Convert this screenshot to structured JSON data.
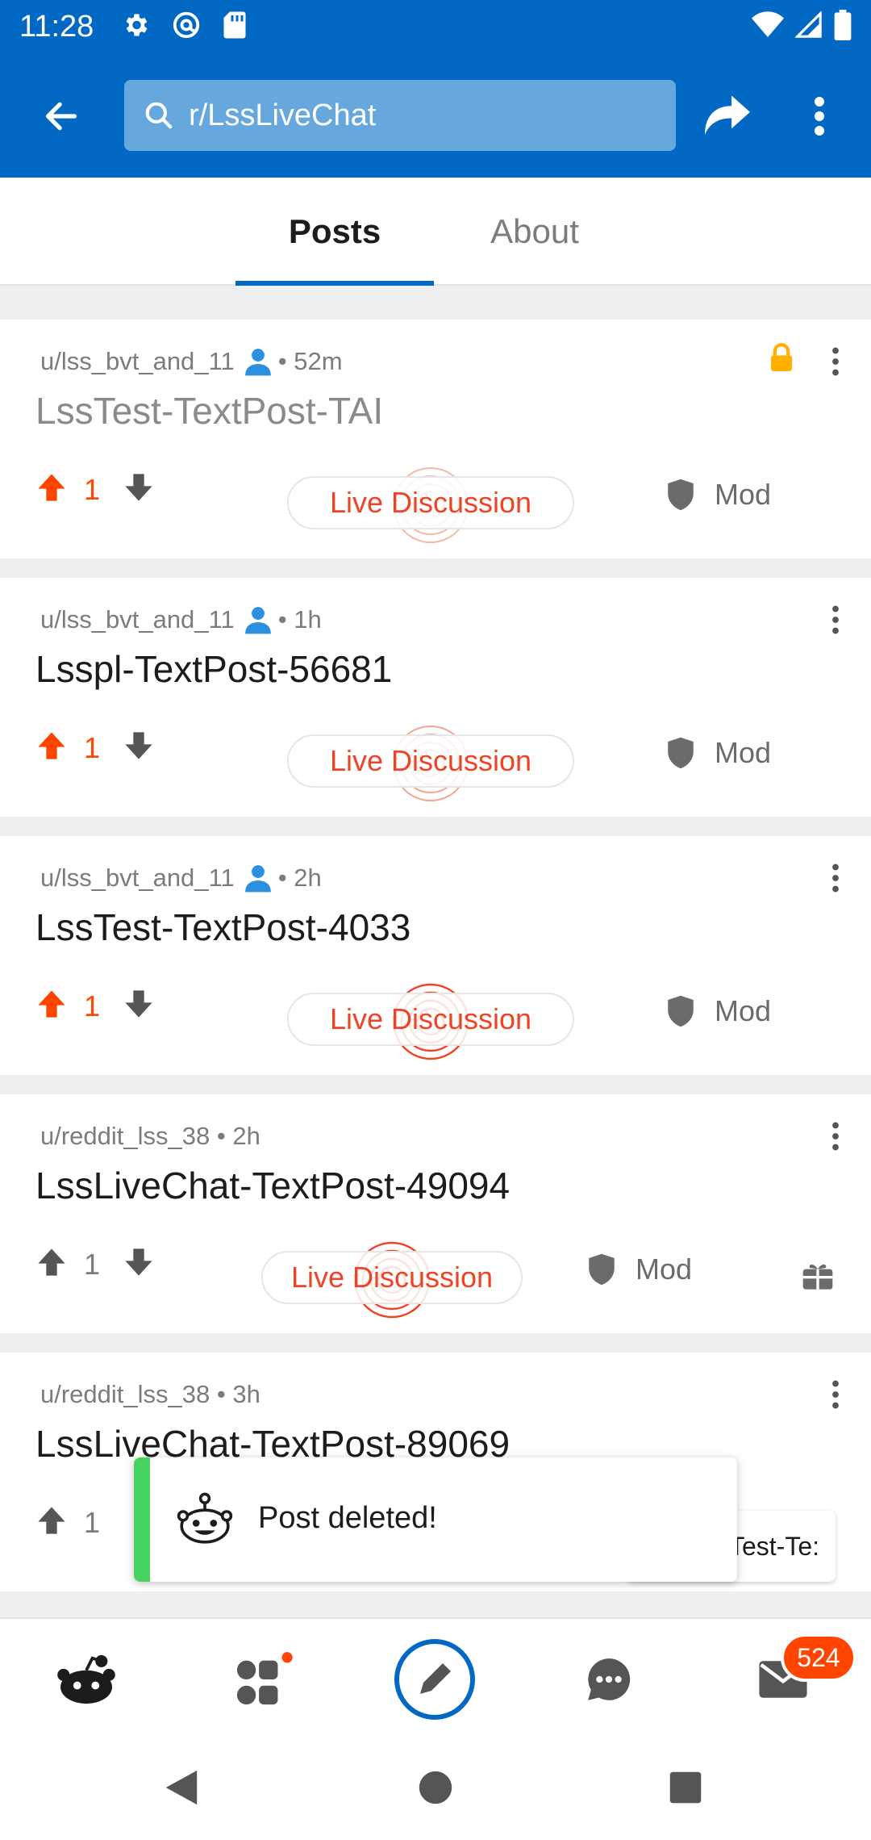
{
  "status_bar": {
    "time": "11:28",
    "left_icons": [
      "settings-icon",
      "at-sign-icon",
      "sd-card-icon"
    ],
    "right_icons": [
      "wifi-icon",
      "cell-signal-icon",
      "battery-icon"
    ]
  },
  "app_bar": {
    "search_value": "r/LssLiveChat",
    "accent_color": "#0169c3"
  },
  "tabs": [
    {
      "label": "Posts",
      "active": true
    },
    {
      "label": "About",
      "active": false
    }
  ],
  "posts": [
    {
      "author": "u/lss_bvt_and_11",
      "verified": true,
      "age": "52m",
      "title": "LssTest-TextPost-TAI",
      "votes": "1",
      "upvoted": true,
      "live_label": "Live Discussion",
      "mod_label": "Mod",
      "locked": true
    },
    {
      "author": "u/lss_bvt_and_11",
      "verified": true,
      "age": "1h",
      "title": "Lsspl-TextPost-56681",
      "votes": "1",
      "upvoted": true,
      "live_label": "Live Discussion",
      "mod_label": "Mod",
      "locked": false
    },
    {
      "author": "u/lss_bvt_and_11",
      "verified": true,
      "age": "2h",
      "title": "LssTest-TextPost-4033",
      "votes": "1",
      "upvoted": true,
      "live_label": "Live Discussion",
      "mod_label": "Mod",
      "locked": false
    },
    {
      "author": "u/reddit_lss_38",
      "verified": false,
      "age": "2h",
      "title": "LssLiveChat-TextPost-49094",
      "votes": "1",
      "upvoted": false,
      "live_label": "Live Discussion",
      "mod_label": "Mod",
      "locked": false
    },
    {
      "author": "u/reddit_lss_38",
      "verified": false,
      "age": "3h",
      "title": "LssLiveChat-TextPost-89069",
      "votes": "1",
      "upvoted": false
    }
  ],
  "meta_separator": "•",
  "toast": {
    "message": "Post deleted!"
  },
  "hidden_chip": {
    "text": "Test-Te:"
  },
  "bottom_nav": {
    "items": [
      "home-icon",
      "communities-icon",
      "create-post-icon",
      "chat-icon",
      "inbox-icon"
    ],
    "inbox_badge": "524"
  },
  "colors": {
    "upvote": "#ff4500",
    "live": "#ef4323",
    "toast_accent": "#46d160",
    "lock": "#ffb000"
  }
}
